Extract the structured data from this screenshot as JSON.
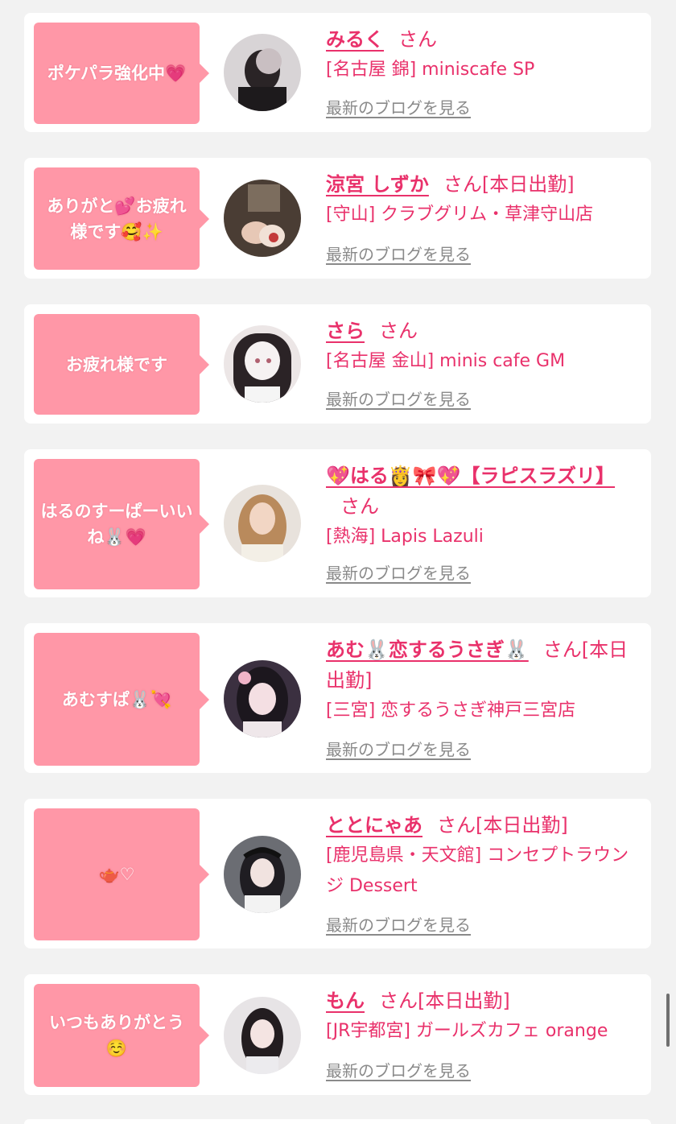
{
  "cards": [
    {
      "bubble": "ポケパラ強化中💗",
      "name": "みるく",
      "san": "さん",
      "shop": "[名古屋 錦] miniscafe SP",
      "blog": "最新のブログを見る"
    },
    {
      "bubble": "ありがと💕お疲れ様です🥰✨",
      "name": "涼宮 しずか",
      "san": "さん[本日出勤]",
      "shop": "[守山] クラブグリム・草津守山店",
      "blog": "最新のブログを見る"
    },
    {
      "bubble": "お疲れ様です",
      "name": "さら",
      "san": "さん",
      "shop": "[名古屋 金山] minis cafe GM",
      "blog": "最新のブログを見る"
    },
    {
      "bubble": "はるのすーぱーいいね🐰💗",
      "name": "💖はる👸🎀💖【ラピスラズリ】",
      "san": "さん",
      "shop": "[熱海] Lapis Lazuli",
      "blog": "最新のブログを見る"
    },
    {
      "bubble": "あむすぱ🐰💘",
      "name": "あむ🐰恋するうさぎ🐰",
      "san": "さん[本日出勤]",
      "shop": "[三宮] 恋するうさぎ神戸三宮店",
      "blog": "最新のブログを見る"
    },
    {
      "bubble": "🫖♡",
      "name": "ととにゃあ",
      "san": "さん[本日出勤]",
      "shop": "[鹿児島県・天文館] コンセプトラウンジ Dessert",
      "blog": "最新のブログを見る"
    },
    {
      "bubble": "いつもありがとう☺️",
      "name": "もん",
      "san": "さん[本日出勤]",
      "shop": "[JR宇都宮] ガールズカフェ orange",
      "blog": "最新のブログを見る"
    }
  ],
  "colors": {
    "accent": "#e9316b",
    "bubble": "#ff97a7",
    "background": "#f2f2f2"
  }
}
